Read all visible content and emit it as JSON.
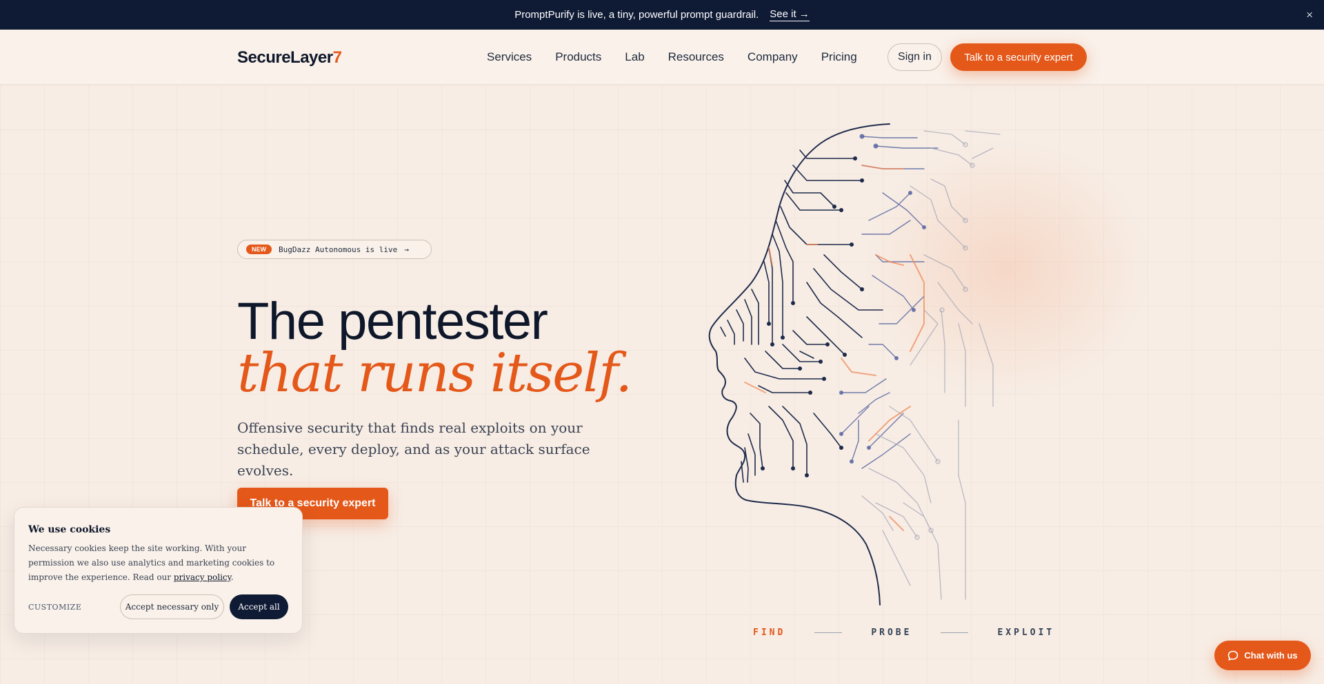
{
  "announcement": {
    "message": "PromptPurify is live, a tiny, powerful prompt guardrail.",
    "link": "See it →",
    "close": "×"
  },
  "header": {
    "logo_text": "SecureLayer",
    "logo_accent": "7",
    "nav": [
      "Services",
      "Products",
      "Lab",
      "Resources",
      "Company",
      "Pricing"
    ],
    "signin": "Sign in",
    "cta": "Talk to a security expert"
  },
  "hero": {
    "badge_tag": "NEW",
    "badge_text": "BugDazz Autonomous is live",
    "badge_arrow": "→",
    "title_line1": "The pentester",
    "title_line2": "that runs itself.",
    "subtitle": "Offensive security that finds real exploits on your schedule, every deploy, and as your attack surface evolves.",
    "cta": "Talk to a security expert"
  },
  "steps": [
    "FIND",
    "PROBE",
    "EXPLOIT"
  ],
  "cookie": {
    "title": "We use cookies",
    "body": "Necessary cookies keep the site working. With your permission we also use analytics and marketing cookies to improve the experience. Read our ",
    "policy_link": "privacy policy",
    "period": ".",
    "customize": "CUSTOMIZE",
    "necessary": "Accept necessary only",
    "accept_all": "Accept all"
  },
  "chat": {
    "label": "Chat with us"
  },
  "colors": {
    "accent": "#e4581a",
    "navy": "#0f1a35",
    "background": "#f7ede5"
  }
}
